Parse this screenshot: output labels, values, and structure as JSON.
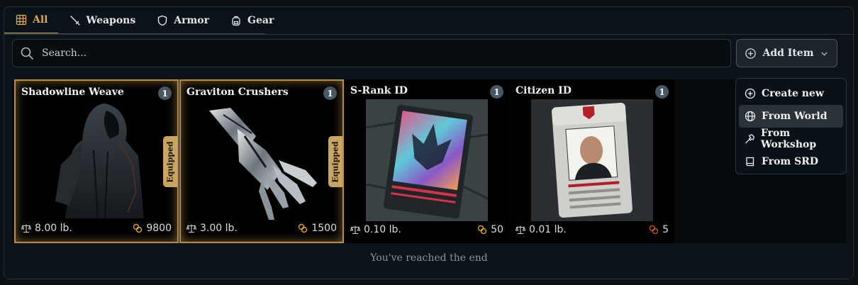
{
  "tabs": [
    {
      "label": "All",
      "icon": "grid-icon",
      "active": true
    },
    {
      "label": "Weapons",
      "icon": "sword-icon"
    },
    {
      "label": "Armor",
      "icon": "shield-icon"
    },
    {
      "label": "Gear",
      "icon": "backpack-icon"
    }
  ],
  "search": {
    "placeholder": "Search...",
    "value": ""
  },
  "add_button": {
    "label": "Add Item"
  },
  "menu": {
    "items": [
      {
        "label": "Create new",
        "icon": "plus-circle-icon"
      },
      {
        "label": "From World",
        "icon": "globe-icon",
        "highlighted": true
      },
      {
        "label": "From Workshop",
        "icon": "hammer-icon"
      },
      {
        "label": "From SRD",
        "icon": "book-icon"
      }
    ]
  },
  "items": [
    {
      "name": "Shadowline Weave",
      "quantity": "1",
      "weight": "8.00 lb.",
      "cost": "9800",
      "equipped": true,
      "equipped_label": "Equipped"
    },
    {
      "name": "Graviton Crushers",
      "quantity": "1",
      "weight": "3.00 lb.",
      "cost": "1500",
      "equipped": true,
      "equipped_label": "Equipped"
    },
    {
      "name": "S-Rank ID",
      "quantity": "1",
      "weight": "0.10 lb.",
      "cost": "50",
      "equipped": false
    },
    {
      "name": "Citizen ID",
      "quantity": "1",
      "weight": "0.01 lb.",
      "cost": "5",
      "equipped": false
    }
  ],
  "end_message": "You've reached the end",
  "colors": {
    "accent": "#d7aa5b",
    "cost_gold": "#d9a429",
    "cost_copper": "#b8561f",
    "equipped_border": "#b98d45"
  }
}
